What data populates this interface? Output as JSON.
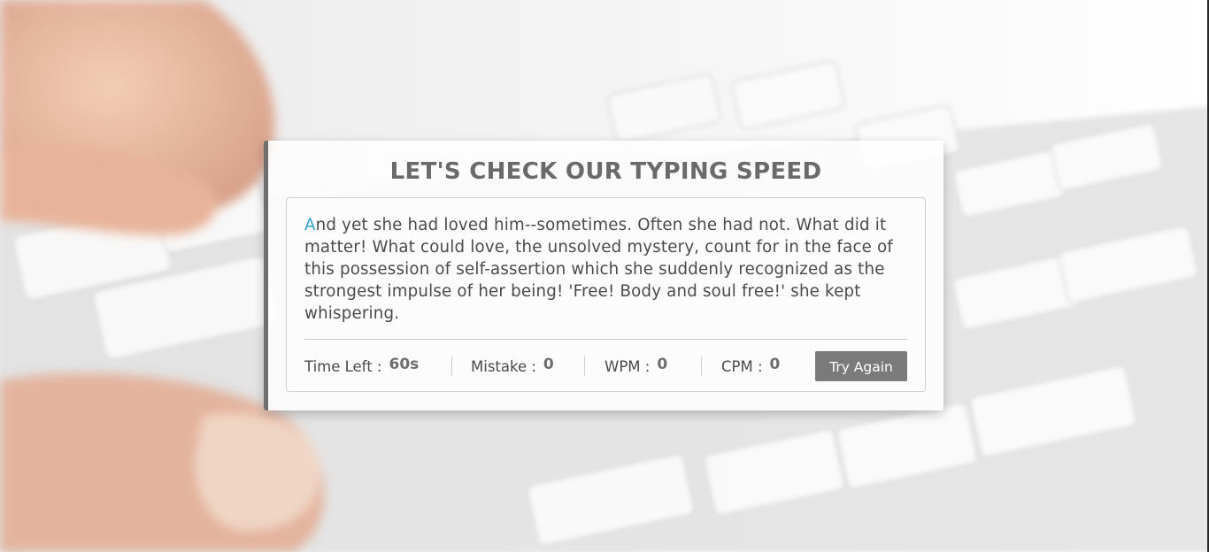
{
  "app": {
    "title": "LET'S CHECK OUR TYPING SPEED"
  },
  "typing_text": {
    "active_char": "A",
    "remaining": "nd yet she had loved him--sometimes. Often she had not. What did it matter! What could love, the unsolved mystery, count for in the face of this possession of self-assertion which she suddenly recognized as the strongest impulse of her being! 'Free! Body and soul free!' she kept whispering."
  },
  "stats": {
    "time_left_label": "Time Left :",
    "time_left_value": "60s",
    "mistake_label": "Mistake :",
    "mistake_value": "0",
    "wpm_label": "WPM :",
    "wpm_value": "0",
    "cpm_label": "CPM :",
    "cpm_value": "0"
  },
  "buttons": {
    "try_again_label": "Try Again"
  },
  "colors": {
    "accent_active_char": "#2fa2c6",
    "button_bg": "#7a7a7a",
    "card_border": "#6f6f6f"
  }
}
